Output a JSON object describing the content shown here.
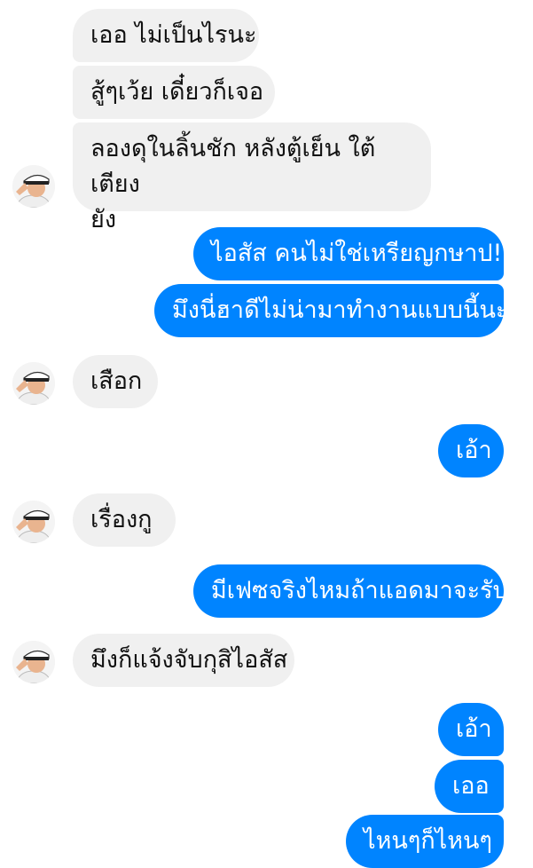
{
  "messages": [
    {
      "side": "in",
      "text": "เออ ไม่เป็นไรนะ"
    },
    {
      "side": "in",
      "text": "สู้ๆเว้ย เดี๋ยวก็เจอ"
    },
    {
      "side": "in",
      "line1": "ลองดุในลิ้นชัก หลังตู้เย็น ใต้เตียง",
      "line2": "ยัง"
    },
    {
      "side": "out",
      "text": "ไอสัส คนไม่ใช่เหรียญกษาป!"
    },
    {
      "side": "out",
      "text": "มึงนี่ฮาดีไม่น่ามาทำงานแบบนี้นะ"
    },
    {
      "side": "in",
      "text": "เสือก"
    },
    {
      "side": "out",
      "text": "เอ้า"
    },
    {
      "side": "in",
      "text": "เรื่องกู"
    },
    {
      "side": "out",
      "text": "มีเฟซจริงไหมถ้าแอดมาจะรับ"
    },
    {
      "side": "in",
      "text": "มึงก็แจ้งจับกุสิไอสัส"
    },
    {
      "side": "out",
      "text": "เอ้า"
    },
    {
      "side": "out",
      "text": "เออ"
    },
    {
      "side": "out",
      "text": "ไหนๆก็ไหนๆ"
    }
  ],
  "colors": {
    "incoming": "#f0f0f0",
    "outgoing": "#0084ff",
    "outgoing_text": "#ffffff"
  },
  "avatar_icon": "user-avatar-captain-hat"
}
